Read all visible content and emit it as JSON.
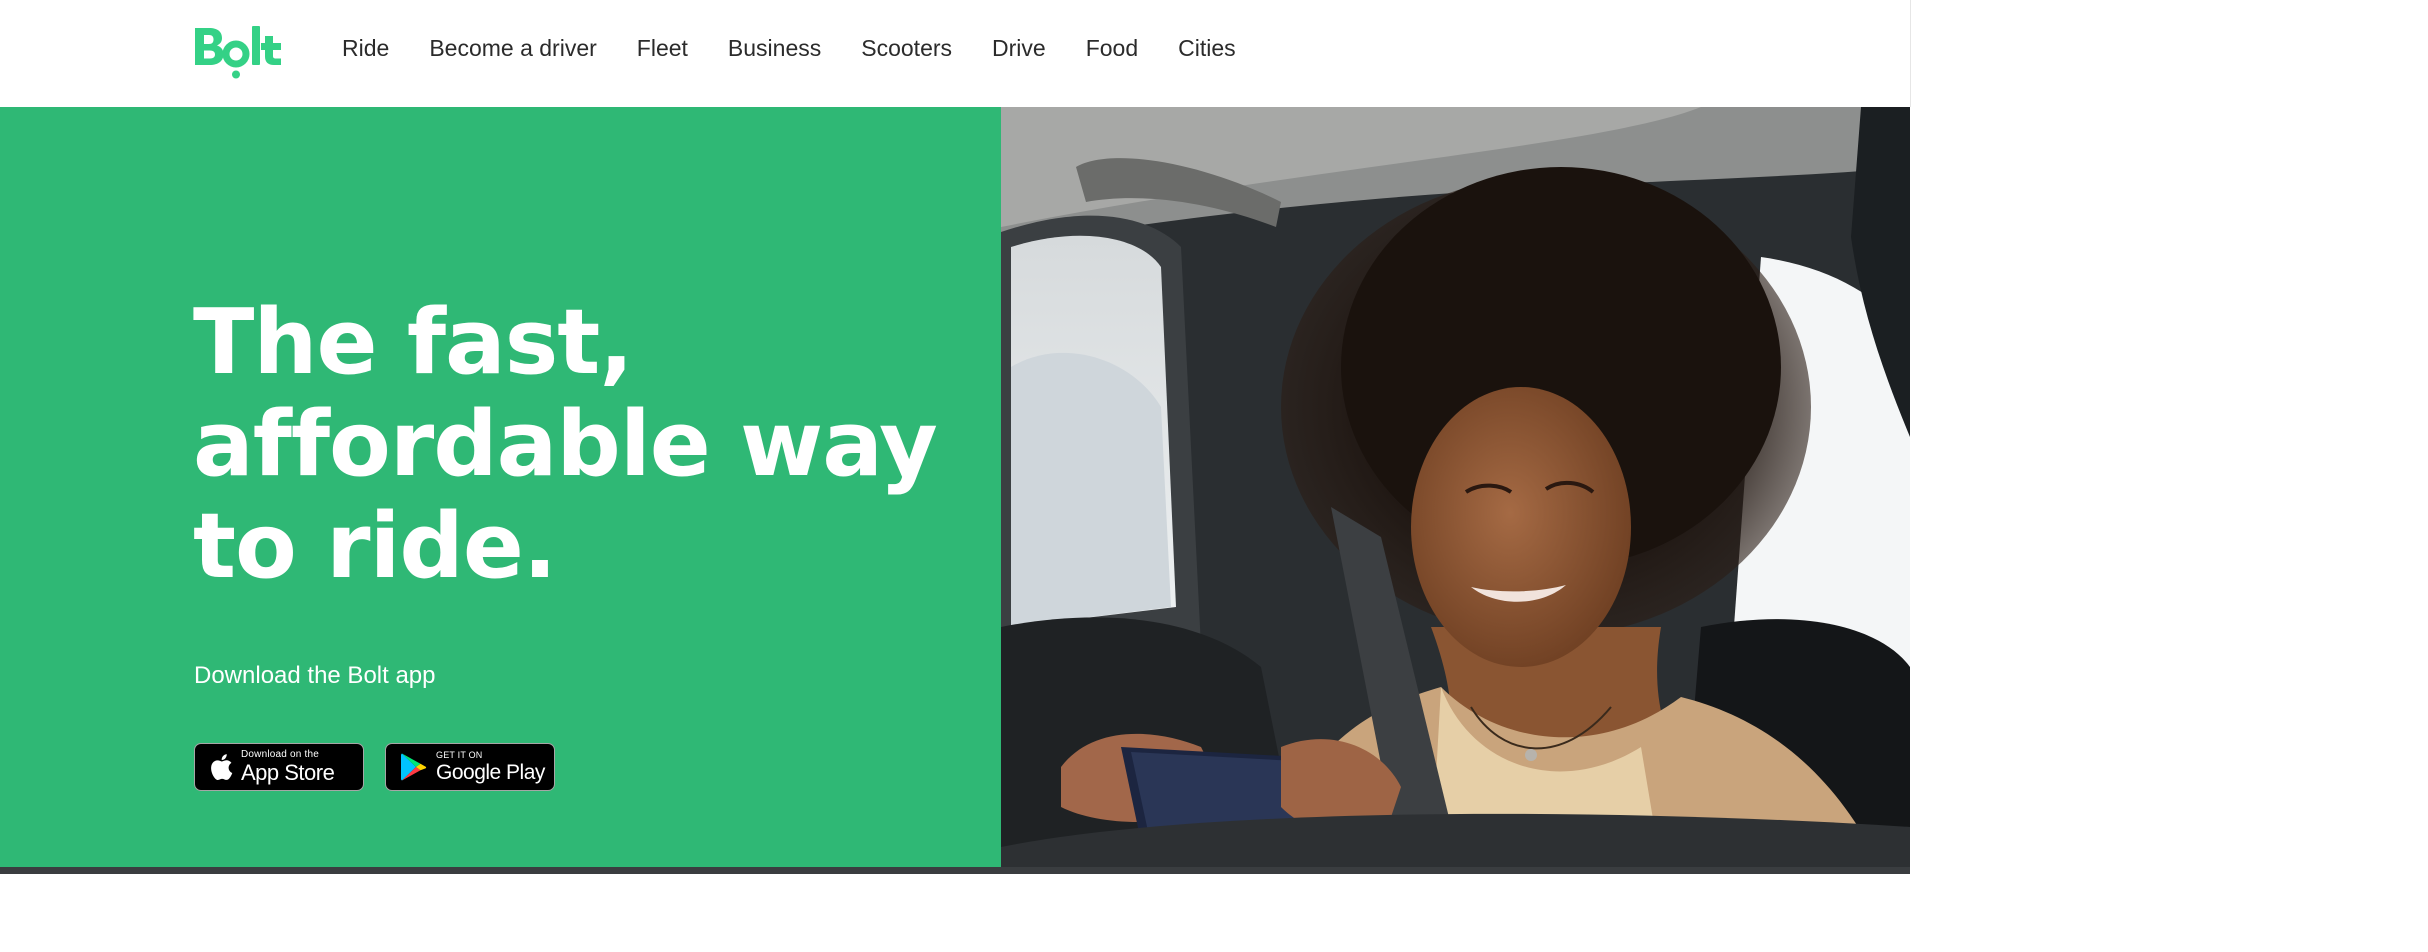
{
  "header": {
    "logo_text": "Bolt",
    "nav": [
      {
        "label": "Ride"
      },
      {
        "label": "Become a driver"
      },
      {
        "label": "Fleet"
      },
      {
        "label": "Business"
      },
      {
        "label": "Scooters"
      },
      {
        "label": "Drive"
      },
      {
        "label": "Food"
      },
      {
        "label": "Cities"
      }
    ]
  },
  "hero": {
    "title_lines": [
      "The fast,",
      "affordable way",
      "to ride."
    ],
    "download_label": "Download the Bolt app",
    "app_store": {
      "small": "Download on the",
      "big": "App Store"
    },
    "google_play": {
      "small": "GET IT ON",
      "big": "Google Play"
    },
    "image": "woman-in-car-back-seat-using-phone"
  },
  "colors": {
    "brand_green": "#2fb875",
    "logo_green": "#34d186",
    "nav_text": "#2b2b2b",
    "store_badge_bg": "#000000"
  }
}
